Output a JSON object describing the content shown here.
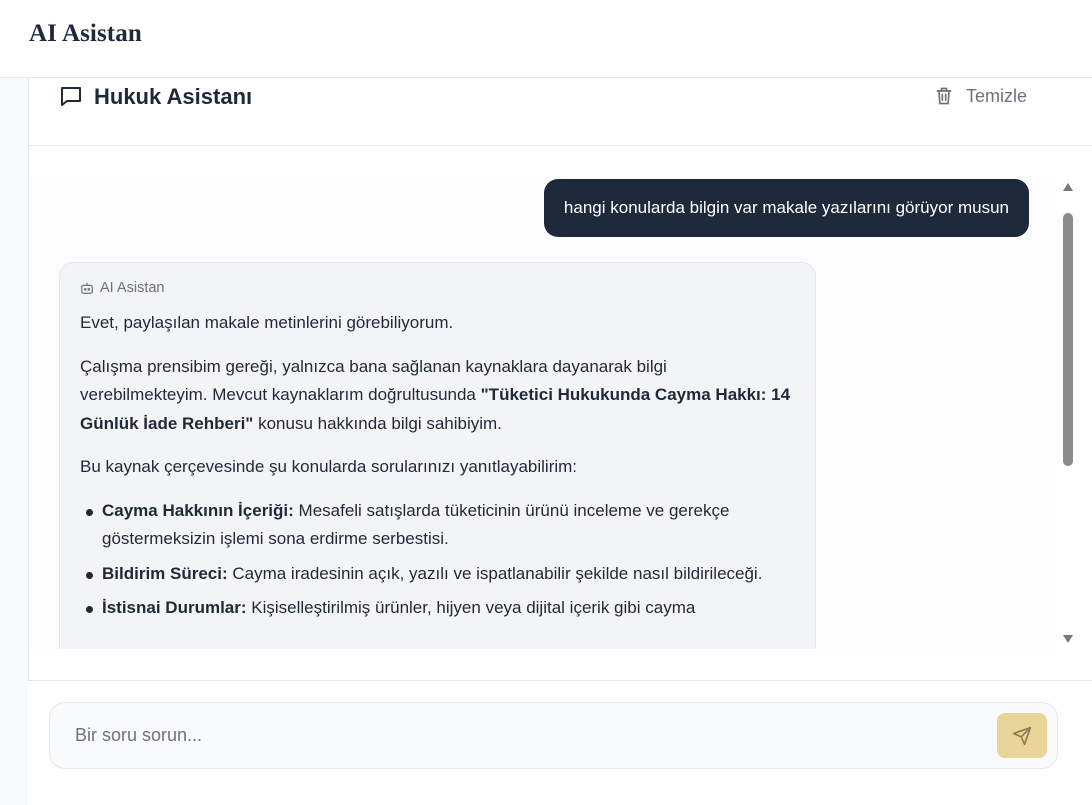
{
  "app": {
    "title": "AI Asistan"
  },
  "card": {
    "title": "Hukuk Asistanı",
    "clear_label": "Temizle"
  },
  "messages": {
    "user": "hangi konularda bilgin var makale yazılarını görüyor musun",
    "ai_label": "AI Asistan",
    "ai_p1": "Evet, paylaşılan makale metinlerini görebiliyorum.",
    "ai_p2_a": "Çalışma prensibim gereği, yalnızca bana sağlanan kaynaklara dayanarak bilgi verebilmekteyim. Mevcut kaynaklarım doğrultusunda ",
    "ai_p2_b": "\"Tüketici Hukukunda Cayma Hakkı: 14 Günlük İade Rehberi\"",
    "ai_p2_c": " konusu hakkında bilgi sahibiyim.",
    "ai_p3": "Bu kaynak çerçevesinde şu konularda sorularınızı yanıtlayabilirim:",
    "bullets": [
      {
        "title": "Cayma Hakkının İçeriği:",
        "text": " Mesafeli satışlarda tüketicinin ürünü inceleme ve gerekçe göstermeksizin işlemi sona erdirme serbestisi."
      },
      {
        "title": "Bildirim Süreci:",
        "text": " Cayma iradesinin açık, yazılı ve ispatlanabilir şekilde nasıl bildirileceği."
      },
      {
        "title": "İstisnai Durumlar:",
        "text": " Kişiselleştirilmiş ürünler, hijyen veya dijital içerik gibi cayma"
      }
    ]
  },
  "composer": {
    "placeholder": "Bir soru sorun..."
  },
  "colors": {
    "user_bubble": "#1e293b",
    "send_button": "#e9d49a",
    "ai_bubble": "#f3f4f6"
  }
}
